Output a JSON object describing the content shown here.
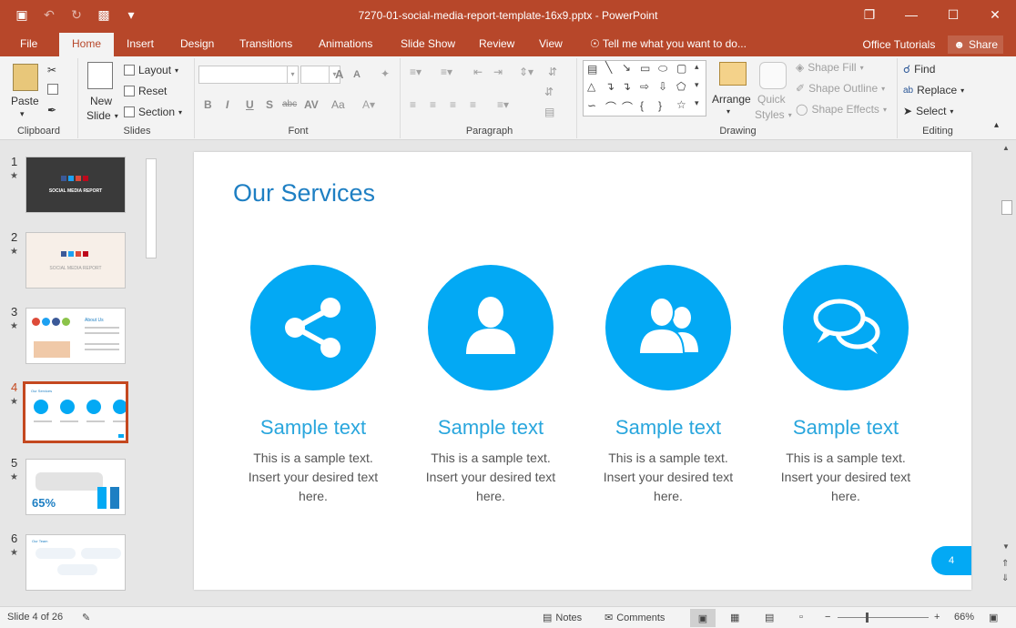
{
  "window": {
    "title": "7270-01-social-media-report-template-16x9.pptx - PowerPoint",
    "qat": [
      {
        "name": "save-icon",
        "glyph": "💾"
      },
      {
        "name": "undo-icon",
        "glyph": "↶"
      },
      {
        "name": "redo-icon",
        "glyph": "↻"
      },
      {
        "name": "present-icon",
        "glyph": "❒"
      },
      {
        "name": "customize-icon",
        "glyph": "▾"
      }
    ],
    "controls": {
      "restore": "❐",
      "minimize": "—",
      "maximize": "☐",
      "close": "✕"
    }
  },
  "tabs": [
    "File",
    "Home",
    "Insert",
    "Design",
    "Transitions",
    "Animations",
    "Slide Show",
    "Review",
    "View"
  ],
  "active_tab": "Home",
  "tell_me": "Tell me what you want to do...",
  "office_tutorials": "Office Tutorials",
  "share_label": "Share",
  "ribbon": {
    "clipboard": {
      "label": "Clipboard",
      "paste": "Paste"
    },
    "slides": {
      "label": "Slides",
      "new_slide_1": "New",
      "new_slide_2": "Slide",
      "layout": "Layout",
      "reset": "Reset",
      "section": "Section"
    },
    "font": {
      "label": "Font",
      "bold": "B",
      "italic": "I",
      "underline": "U",
      "shadow": "S",
      "strike": "abc",
      "spacing": "AV",
      "case": "Aa",
      "grow": "A",
      "shrink": "A"
    },
    "paragraph": {
      "label": "Paragraph"
    },
    "drawing": {
      "label": "Drawing",
      "arrange": "Arrange",
      "quick_styles_1": "Quick",
      "quick_styles_2": "Styles",
      "shape_fill": "Shape Fill",
      "shape_outline": "Shape Outline",
      "shape_effects": "Shape Effects"
    },
    "editing": {
      "label": "Editing",
      "find": "Find",
      "replace": "Replace",
      "select": "Select"
    }
  },
  "thumbnails": [
    {
      "num": "1",
      "caption": "SOCIAL MEDIA REPORT",
      "bg": "#3a3a3a"
    },
    {
      "num": "2",
      "caption": "SOCIAL MEDIA REPORT",
      "bg": "#f7efe8"
    },
    {
      "num": "3",
      "caption": "About Us",
      "bg": "#ffffff"
    },
    {
      "num": "4",
      "caption": "Our Services",
      "bg": "#ffffff"
    },
    {
      "num": "5",
      "caption": "65%",
      "bg": "#ffffff"
    },
    {
      "num": "6",
      "caption": "Our Team",
      "bg": "#ffffff"
    }
  ],
  "selected_slide": "4",
  "slide": {
    "title": "Our Services",
    "page_number": "4",
    "services": [
      {
        "icon": "share-icon",
        "title": "Sample text",
        "line1": "This is a sample text.",
        "line2": "Insert your desired text",
        "line3": "here."
      },
      {
        "icon": "user-icon",
        "title": "Sample text",
        "line1": "This is a sample text.",
        "line2": "Insert your desired text",
        "line3": "here."
      },
      {
        "icon": "users-icon",
        "title": "Sample text",
        "line1": "This is a sample text.",
        "line2": "Insert your desired text",
        "line3": "here."
      },
      {
        "icon": "chat-icon",
        "title": "Sample text",
        "line1": "This is a sample text.",
        "line2": "Insert your desired text",
        "line3": "here."
      }
    ]
  },
  "status": {
    "slide_info": "Slide 4 of 26",
    "notes": "Notes",
    "comments": "Comments",
    "zoom_in": "+",
    "zoom_out": "−",
    "zoom": "66%"
  },
  "colors": {
    "accent": "#b7472a",
    "circle": "#03a9f4",
    "title": "#1e7fc3",
    "subtitle": "#29a6dd"
  }
}
